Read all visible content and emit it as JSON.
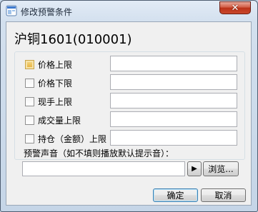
{
  "window": {
    "title": "修改预警条件",
    "close_glyph": "✕"
  },
  "instrument": {
    "name": "沪铜1601(010001)"
  },
  "conditions": [
    {
      "label": "价格上限",
      "checked": false,
      "value": ""
    },
    {
      "label": "价格下限",
      "checked": false,
      "value": ""
    },
    {
      "label": "现手上限",
      "checked": false,
      "value": ""
    },
    {
      "label": "成交量上限",
      "checked": false,
      "value": ""
    },
    {
      "label": "持仓（金额）上限",
      "checked": false,
      "value": ""
    }
  ],
  "sound": {
    "label": "预警声音（如不填则播放默认提示音）：",
    "value": "",
    "play_glyph": "▶",
    "browse_label": "浏览..."
  },
  "buttons": {
    "ok": "确定",
    "cancel": "取消"
  },
  "icons": {
    "app": "app-window-icon",
    "close": "close-icon",
    "play": "play-icon"
  }
}
